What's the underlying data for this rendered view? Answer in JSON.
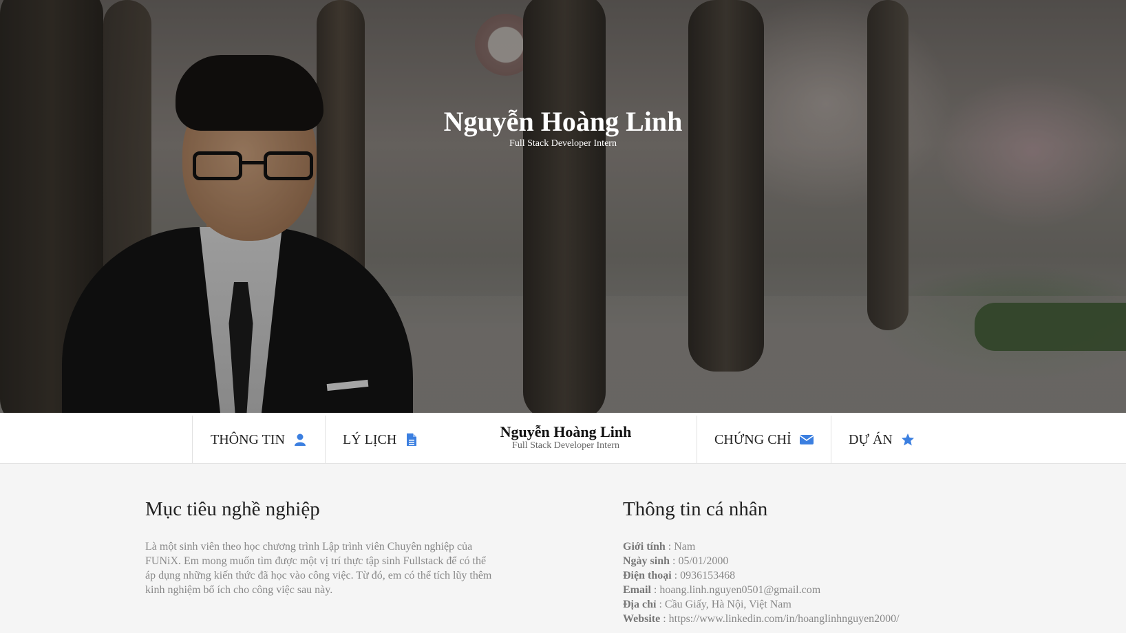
{
  "hero": {
    "name": "Nguyễn Hoàng Linh",
    "role": "Full Stack Developer Intern"
  },
  "nav": {
    "items": [
      {
        "label": "THÔNG TIN",
        "icon": "user-icon"
      },
      {
        "label": "LÝ LỊCH",
        "icon": "file-icon"
      },
      {
        "label": "CHỨNG CHỈ",
        "icon": "envelope-icon"
      },
      {
        "label": "DỰ ÁN",
        "icon": "star-icon"
      }
    ],
    "center_name": "Nguyễn Hoàng Linh",
    "center_role": "Full Stack Developer Intern",
    "accent": "#3b7fe0"
  },
  "objective": {
    "title": "Mục tiêu nghề nghiệp",
    "text": "Là một sinh viên theo học chương trình Lập trình viên Chuyên nghiệp của FUNiX. Em mong muốn tìm được một vị trí thực tập sinh Fullstack để có thể áp dụng những kiến thức đã học vào công việc. Từ đó, em có thể tích lũy thêm kinh nghiệm bổ ích cho công việc sau này."
  },
  "personal": {
    "title": "Thông tin cá nhân",
    "rows": [
      {
        "label": "Giới tính",
        "value": "Nam"
      },
      {
        "label": "Ngày sinh",
        "value": "05/01/2000"
      },
      {
        "label": "Điện thoại",
        "value": "0936153468"
      },
      {
        "label": "Email",
        "value": "hoang.linh.nguyen0501@gmail.com"
      },
      {
        "label": "Địa chỉ",
        "value": "Cầu Giấy, Hà Nội, Việt Nam"
      },
      {
        "label": "Website",
        "value": "https://www.linkedin.com/in/hoanglinhnguyen2000/"
      }
    ]
  }
}
